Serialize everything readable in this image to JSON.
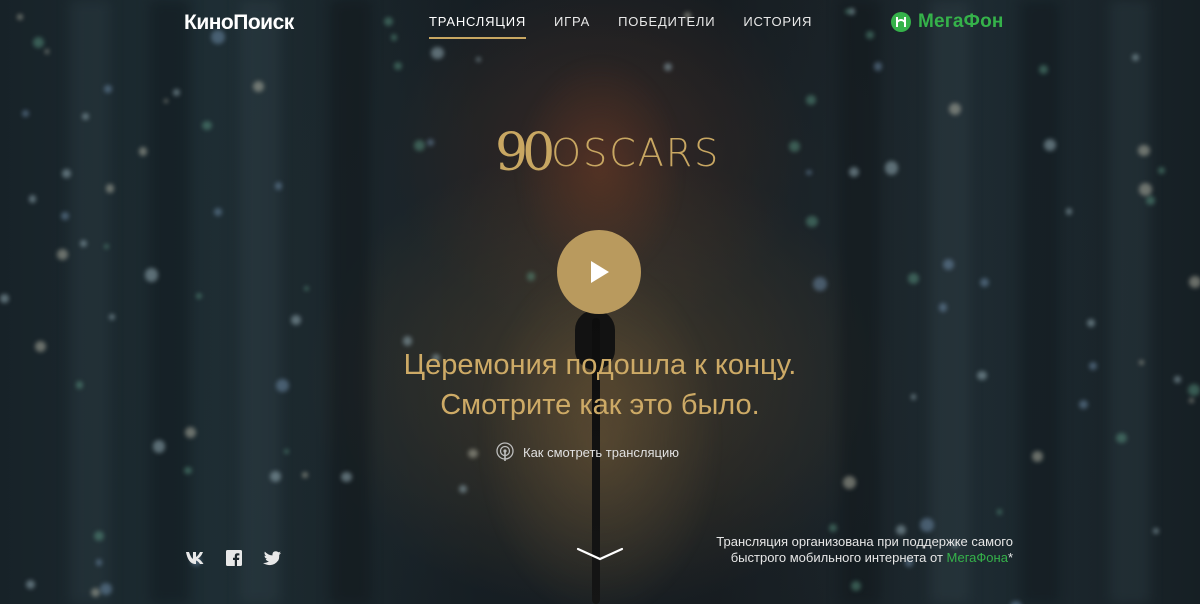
{
  "header": {
    "logo": "КиноПоиск",
    "nav": [
      "ТРАНСЛЯЦИЯ",
      "ИГРА",
      "ПОБЕДИТЕЛИ",
      "ИСТОРИЯ"
    ],
    "active_nav": "ТРАНСЛЯЦИЯ",
    "sponsor_logo": "МегаФон"
  },
  "hero": {
    "event_logo_number": "90",
    "event_logo_word": "OSCARS",
    "headline_line1": "Церемония подошла к концу.",
    "headline_line2": "Смотрите как это было.",
    "how_to_watch": "Как смотреть трансляцию"
  },
  "footer": {
    "socials": [
      "vk-icon",
      "facebook-icon",
      "twitter-icon"
    ],
    "sponsor_line1": "Трансляция организована при поддержке самого",
    "sponsor_line2_prefix": "быстрого мобильного интернета от ",
    "sponsor_brand": "МегаФона",
    "sponsor_suffix": "*"
  },
  "colors": {
    "gold": "#c8a762",
    "play_button": "#b99a5e",
    "megafon_green": "#35b24a"
  }
}
